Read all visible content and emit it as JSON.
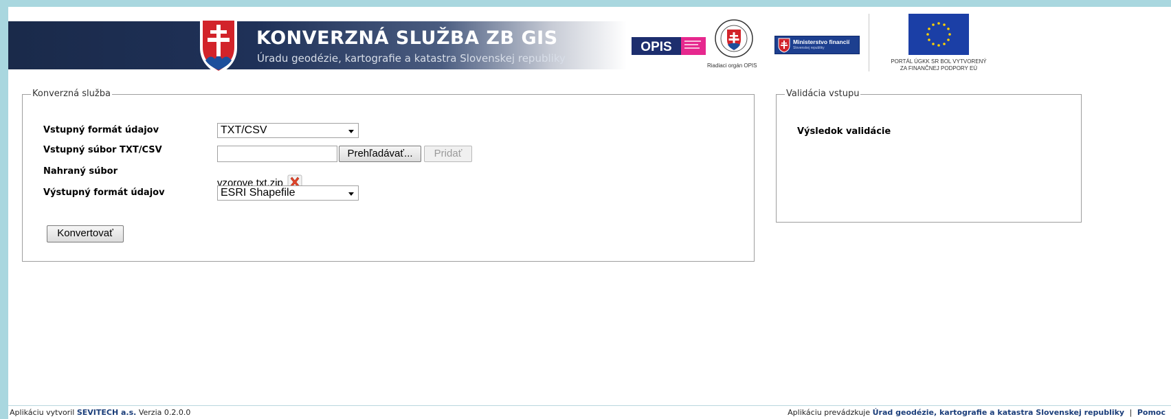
{
  "header": {
    "title": "KONVERZNÁ SLUŽBA ZB GIS",
    "subtitle": "Úradu geodézie, kartografie a katastra Slovenskej republiky",
    "opis_logo_text": "OPIS",
    "seal_caption": "Riadiaci orgán OPIS",
    "minfin_label": "Ministerstvo financií",
    "minfin_sub": "Slovenskej republiky",
    "eu_caption_line1": "PORTÁL ÚGKK SR BOL VYTVORENÝ",
    "eu_caption_line2": "ZA FINANČNEJ PODPORY EÚ"
  },
  "conversion": {
    "legend": "Konverzná služba",
    "input_format_label": "Vstupný formát údajov",
    "input_format_value": "TXT/CSV",
    "input_file_label": "Vstupný súbor TXT/CSV",
    "browse_label": "Prehľadávať...",
    "add_label": "Pridať",
    "uploaded_label": "Nahraný súbor",
    "uploaded_file": "vzorove txt.zip",
    "output_format_label": "Výstupný formát údajov",
    "output_format_value": "ESRI Shapefile",
    "convert_label": "Konvertovať"
  },
  "validation": {
    "legend": "Validácia vstupu",
    "result_title": "Výsledok validácie"
  },
  "footer": {
    "created_by": "Aplikáciu vytvoril",
    "company": "SEVITECH a.s.",
    "version": "Verzia 0.2.0.0",
    "operated_by": "Aplikáciu prevádzkuje",
    "operator": "Úrad geodézie, kartografie a katastra Slovenskej republiky",
    "separator": "|",
    "help": "Pomoc"
  },
  "colors": {
    "background": "#a9d7df",
    "banner_dark": "#1f3158",
    "link": "#1b3e7a"
  }
}
